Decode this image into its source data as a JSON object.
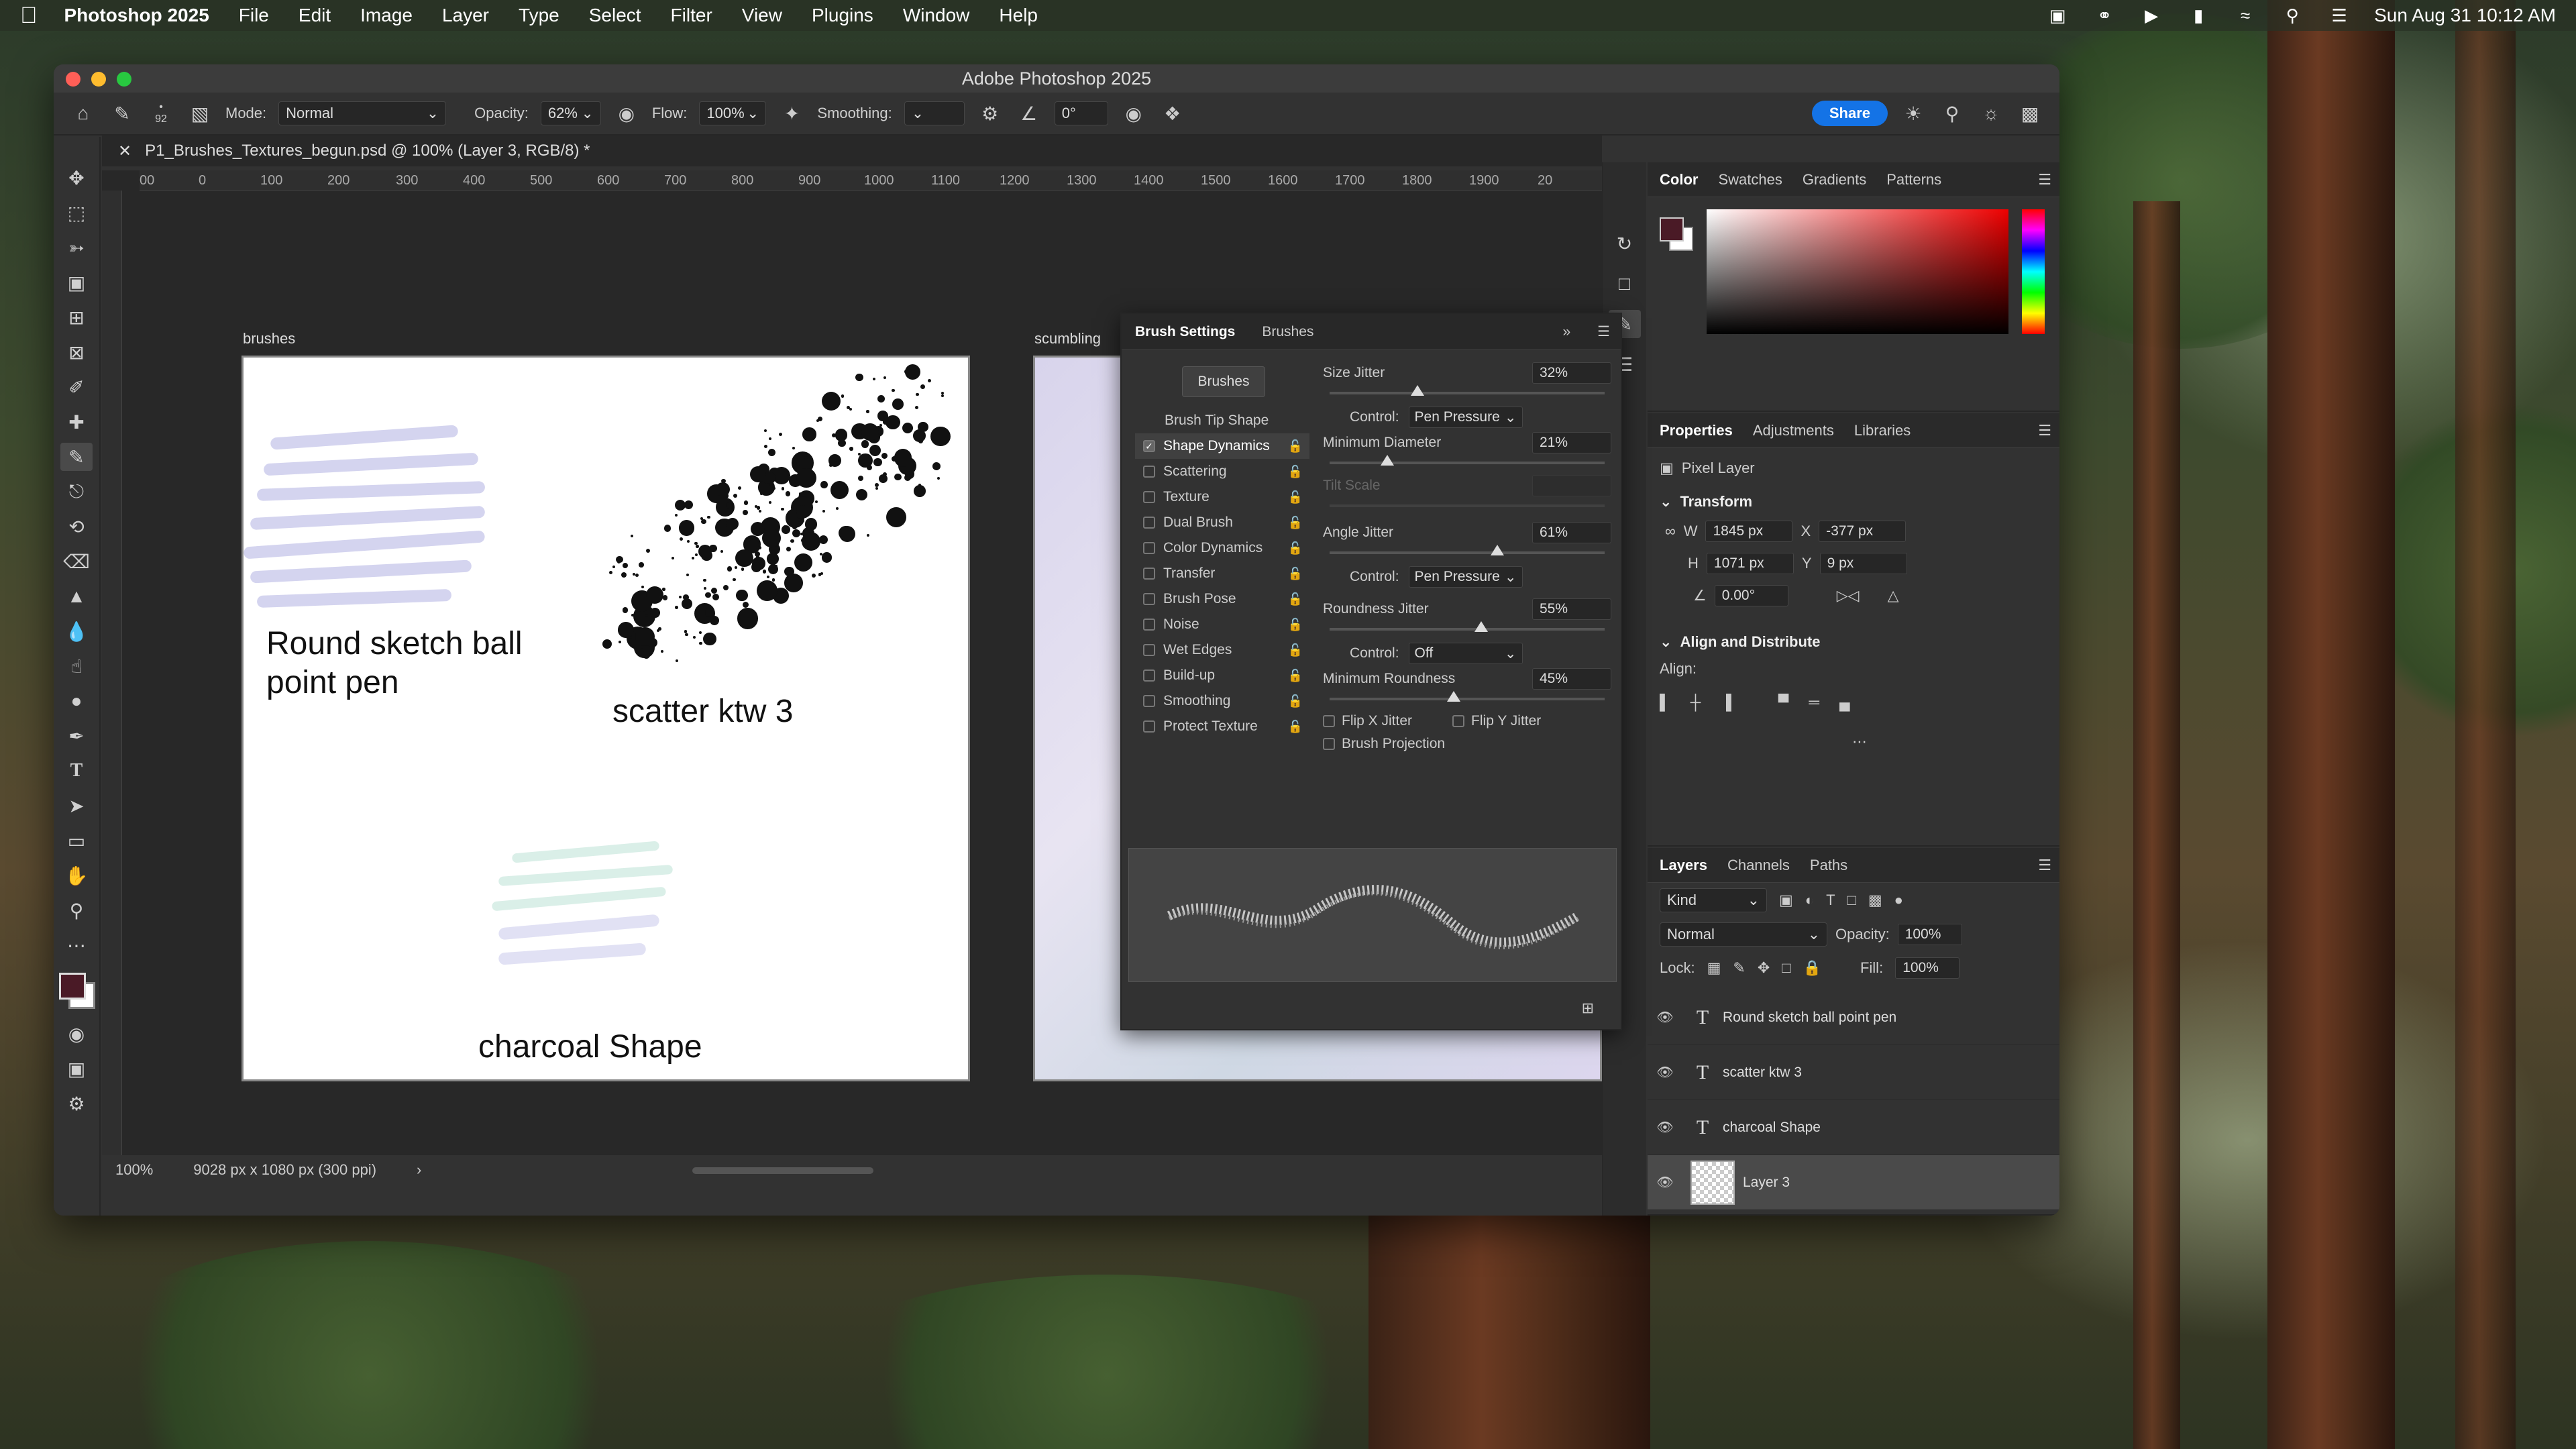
{
  "menubar": {
    "app_name": "Photoshop 2025",
    "items": [
      "File",
      "Edit",
      "Image",
      "Layer",
      "Type",
      "Select",
      "Filter",
      "View",
      "Plugins",
      "Window",
      "Help"
    ],
    "datetime": "Sun Aug 31  10:12 AM"
  },
  "window": {
    "title": "Adobe Photoshop 2025",
    "doc_tab": "P1_Brushes_Textures_begun.psd @ 100% (Layer 3, RGB/8) *"
  },
  "options": {
    "brush_size": "92",
    "mode_label": "Mode:",
    "mode_value": "Normal",
    "opacity_label": "Opacity:",
    "opacity_value": "62%",
    "flow_label": "Flow:",
    "flow_value": "100%",
    "smoothing_label": "Smoothing:",
    "angle_value": "0°",
    "share_label": "Share"
  },
  "canvas": {
    "ruler_ticks": [
      "00",
      "0",
      "100",
      "200",
      "300",
      "400",
      "500",
      "600",
      "700",
      "800",
      "900",
      "1000",
      "1100",
      "1200",
      "1300",
      "1400",
      "1500",
      "1600",
      "1700",
      "1800",
      "1900",
      "20"
    ],
    "artboard1_label": "brushes",
    "artboard2_label": "scumbling",
    "text1_line1": "Round sketch ball",
    "text1_line2": "point pen",
    "text2": "scatter ktw 3",
    "text3": "charcoal Shape"
  },
  "status": {
    "zoom": "100%",
    "doc_info": "9028 px x 1080 px (300 ppi)",
    "arrow": "›"
  },
  "brush_settings": {
    "tab_active": "Brush Settings",
    "tab_other": "Brushes",
    "brushes_button": "Brushes",
    "tip_shape": "Brush Tip Shape",
    "options": [
      {
        "label": "Shape Dynamics",
        "checked": true
      },
      {
        "label": "Scattering",
        "checked": false
      },
      {
        "label": "Texture",
        "checked": false
      },
      {
        "label": "Dual Brush",
        "checked": false
      },
      {
        "label": "Color Dynamics",
        "checked": false
      },
      {
        "label": "Transfer",
        "checked": false
      },
      {
        "label": "Brush Pose",
        "checked": false
      },
      {
        "label": "Noise",
        "checked": false
      },
      {
        "label": "Wet Edges",
        "checked": false
      },
      {
        "label": "Build-up",
        "checked": false
      },
      {
        "label": "Smoothing",
        "checked": false
      },
      {
        "label": "Protect Texture",
        "checked": false
      }
    ],
    "size_jitter_label": "Size Jitter",
    "size_jitter": "32%",
    "control_label": "Control:",
    "control1": "Pen Pressure",
    "min_diameter_label": "Minimum Diameter",
    "min_diameter": "21%",
    "tilt_scale_label": "Tilt Scale",
    "angle_jitter_label": "Angle Jitter",
    "angle_jitter": "61%",
    "control2": "Pen Pressure",
    "roundness_jitter_label": "Roundness Jitter",
    "roundness_jitter": "55%",
    "control3": "Off",
    "min_roundness_label": "Minimum Roundness",
    "min_roundness": "45%",
    "flip_x": "Flip X Jitter",
    "flip_y": "Flip Y Jitter",
    "projection": "Brush Projection",
    "slider_levels": {
      "size_jitter": 0.32,
      "min_diameter": 0.21,
      "angle_jitter": 0.61,
      "roundness_jitter": 0.55,
      "min_roundness": 0.45
    }
  },
  "color_panel": {
    "tabs": [
      "Color",
      "Swatches",
      "Gradients",
      "Patterns"
    ],
    "foreground": "#4a1a26",
    "background": "#ffffff"
  },
  "properties": {
    "tabs": [
      "Properties",
      "Adjustments",
      "Libraries"
    ],
    "kind": "Pixel Layer",
    "transform_title": "Transform",
    "w_label": "W",
    "w": "1845 px",
    "x_label": "X",
    "x": "-377 px",
    "h_label": "H",
    "h": "1071 px",
    "y_label": "Y",
    "y": "9 px",
    "angle": "0.00°",
    "align_title": "Align and Distribute",
    "align_label": "Align:"
  },
  "layers": {
    "tabs": [
      "Layers",
      "Channels",
      "Paths"
    ],
    "filter": "Kind",
    "blend": "Normal",
    "opacity_label": "Opacity:",
    "opacity": "100%",
    "lock_label": "Lock:",
    "fill_label": "Fill:",
    "fill": "100%",
    "rows": [
      {
        "name": "Round sketch ball  point pen",
        "type": "T"
      },
      {
        "name": "scatter ktw 3",
        "type": "T"
      },
      {
        "name": "charcoal Shape",
        "type": "T"
      },
      {
        "name": "Layer 3",
        "type": "pixel"
      }
    ]
  }
}
